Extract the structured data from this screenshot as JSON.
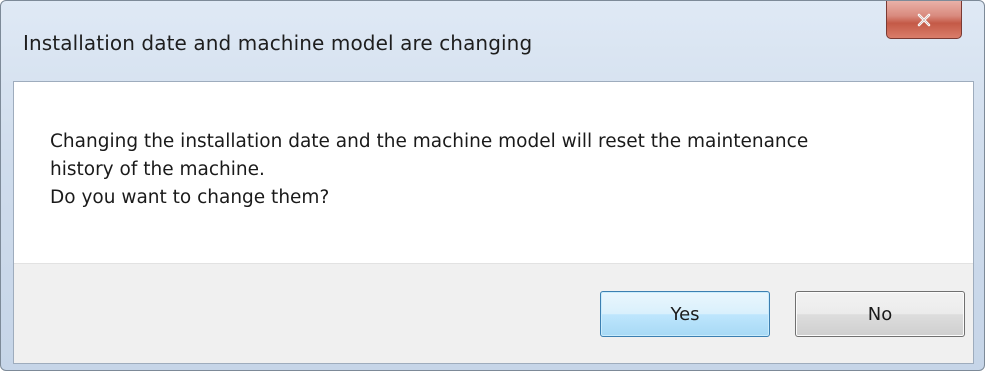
{
  "dialog": {
    "title": "Installation date and machine model are changing",
    "close_icon": "close-icon",
    "message_lines": [
      "Changing the installation date and the machine model will reset the maintenance",
      "history of the machine.",
      "Do you want to change them?"
    ],
    "buttons": {
      "yes_label": "Yes",
      "no_label": "No"
    },
    "colors": {
      "close_button": "#c45a47",
      "default_button_border": "#3c7fb1",
      "titlebar": "#cfdcec"
    }
  }
}
